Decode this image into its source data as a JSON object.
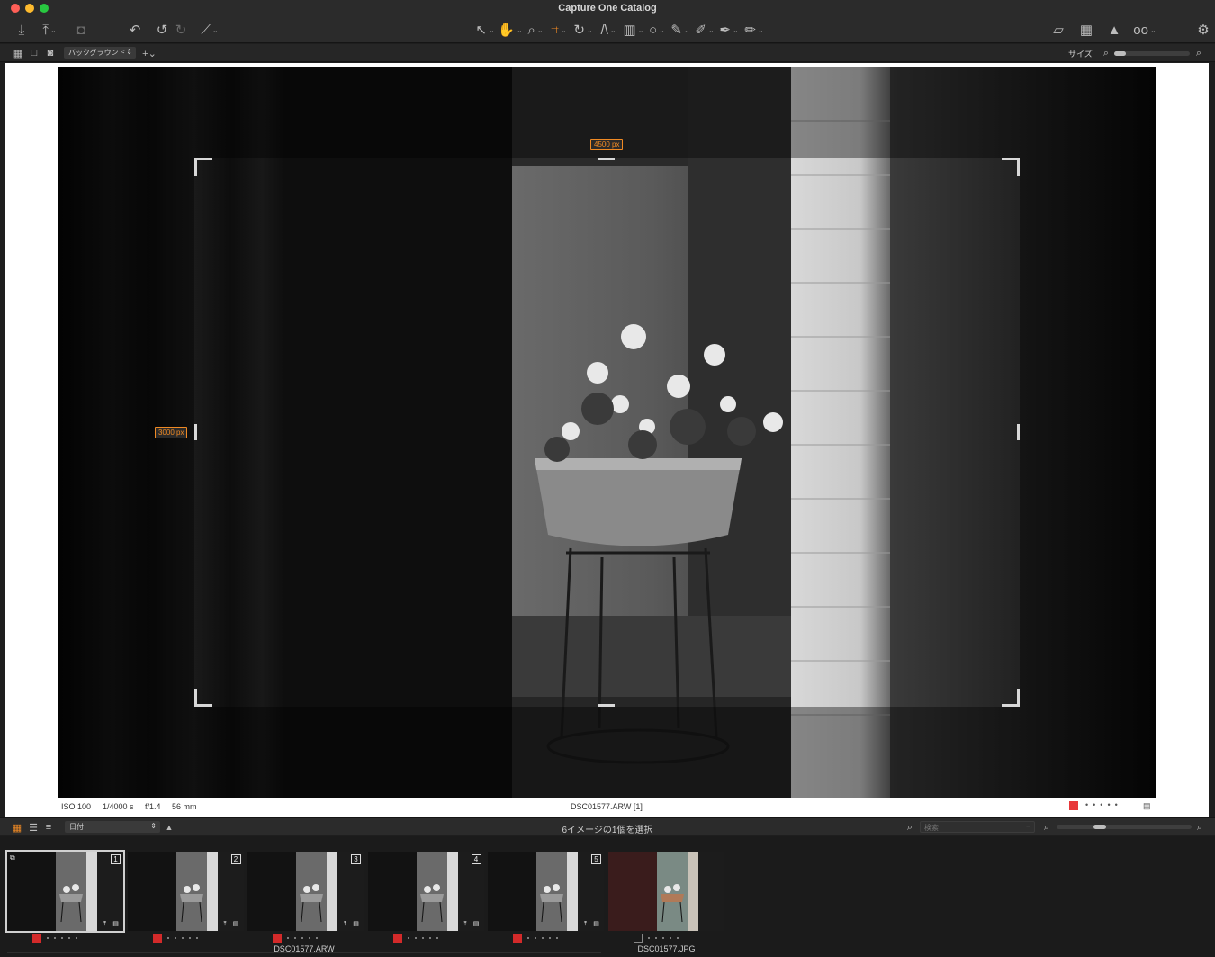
{
  "window": {
    "title": "Capture One Catalog"
  },
  "toolbar": {
    "left_icons": [
      "import-icon",
      "export-icon",
      "camera-icon",
      "reset-icon",
      "undo-icon",
      "redo-icon",
      "auto-adjust-icon"
    ],
    "center_icons": [
      "select-cursor-icon",
      "pan-hand-icon",
      "zoom-icon",
      "crop-icon",
      "rotate-icon",
      "keystone-icon",
      "gradient-mask-icon",
      "circle-mask-icon",
      "brush-icon",
      "clone-icon",
      "picker-icon",
      "annotate-icon"
    ],
    "right_icons": [
      "edit-icon",
      "grid-icon",
      "exposure-warning-icon",
      "loupe-glasses-icon",
      "workspace-icon"
    ],
    "accent": "#f08a24"
  },
  "viewer_bar": {
    "background_select": "バックグラウンド",
    "size_label": "サイズ",
    "size_slider_value": 0.15
  },
  "viewer": {
    "crop_width_label": "4500 px",
    "crop_height_label": "3000 px",
    "iso": "ISO 100",
    "shutter": "1/4000 s",
    "aperture": "f/1.4",
    "focal": "56 mm",
    "filename": "DSC01577.ARW [1]",
    "color_tag": "#e8383a"
  },
  "browser": {
    "sort_select": "日付",
    "selection_status": "6イメージの1個を選択",
    "search_placeholder": "検索",
    "thumb_size_value": 0.3
  },
  "filmstrip": {
    "items": [
      {
        "num": "1",
        "tag": "red",
        "selected": true,
        "color": false
      },
      {
        "num": "2",
        "tag": "red",
        "selected": false,
        "color": false
      },
      {
        "num": "3",
        "tag": "red",
        "selected": false,
        "color": false
      },
      {
        "num": "4",
        "tag": "red",
        "selected": false,
        "color": false
      },
      {
        "num": "5",
        "tag": "red",
        "selected": false,
        "color": false
      },
      {
        "num": "",
        "tag": "none",
        "selected": false,
        "color": true
      }
    ],
    "group_name_raw": "DSC01577.ARW",
    "group_name_jpg": "DSC01577.JPG"
  }
}
